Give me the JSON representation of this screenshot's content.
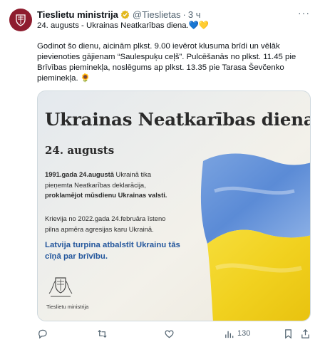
{
  "tweet": {
    "author_name": "Tieslietu ministrija",
    "handle": "@Tieslietas",
    "separator": "·",
    "time": "3 ч",
    "more_glyph": "···",
    "line1": "24. augusts - Ukrainas Neatkarības diena.💙💛",
    "body": "Godinot šo dienu, aicinām plkst. 9.00 ievērot klusuma brīdi un vēlāk pievienoties gājienam “Saulespuķu ceļš”. Pulcēšanās no plkst. 11.45 pie Brīvības pieminekļa, noslēgums ap plkst. 13.35 pie Tarasa Ševčenko pieminekļa. 🌻"
  },
  "card": {
    "title": "Ukrainas Neatkarības diena",
    "date": "24. augusts",
    "p1_bold1": "1991.gada 24.augustā",
    "p1_mid": " Ukrainā tika pieņemta Neatkarības deklarācija, ",
    "p1_bold2": "proklamējot mūsdienu Ukrainas valsti.",
    "p2": "Krievija no 2022.gada 24.februāra īsteno pilna apmēra agresijas karu Ukrainā.",
    "p3": "Latvija turpina atbalstīt Ukrainu tās cīņā par brīvību.",
    "logo_label": "Tieslietu ministrija"
  },
  "actions": {
    "views": "130"
  },
  "colors": {
    "brand": "#8e1c2e",
    "verified": "#e2b719",
    "flag_blue": "#5b8bd6",
    "flag_yellow": "#f1d11f",
    "link_blue": "#23569c"
  }
}
